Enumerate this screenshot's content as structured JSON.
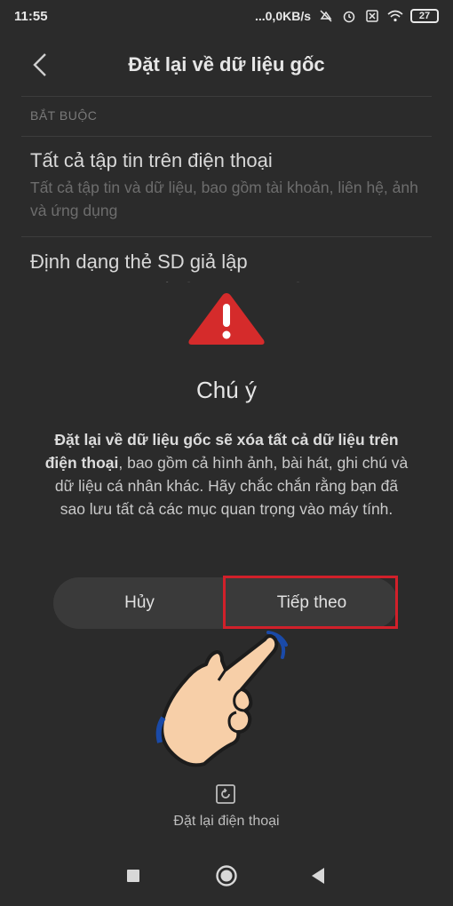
{
  "status_bar": {
    "time": "11:55",
    "net_speed": "...0,0KB/s",
    "battery": "27",
    "icons": [
      "mute-icon",
      "alarm-icon",
      "sim-off-icon",
      "wifi-icon",
      "battery-icon"
    ]
  },
  "header": {
    "title": "Đặt lại về dữ liệu gốc",
    "back_icon": "chevron-left-icon"
  },
  "section_label": "BẮT BUỘC",
  "options": [
    {
      "title": "Tất cả tập tin trên điện thoại",
      "desc": "Tất cả tập tin và dữ liệu, bao gồm tài khoản, liên hệ, ảnh và ứng dụng"
    },
    {
      "title": "Định dạng thẻ SD giả lập",
      "desc": "Định dạng sẽ xóa tất cả dữ liệu trên thẻ SD"
    }
  ],
  "dialog": {
    "icon": "warning-icon",
    "title": "Chú ý",
    "body_bold": "Đặt lại về dữ liệu gốc sẽ xóa tất cả dữ liệu trên điện thoại",
    "body_rest": ", bao gồm cả hình ảnh, bài hát, ghi chú và dữ liệu cá nhân khác. Hãy chắc chắn rằng bạn đã sao lưu tất cả các mục quan trọng vào máy tính.",
    "cancel_label": "Hủy",
    "next_label": "Tiếp theo",
    "highlight_color": "#d1202a"
  },
  "reset": {
    "icon": "reset-icon",
    "label": "Đặt lại điện thoại"
  },
  "nav_bar": {
    "icons": [
      "recents-icon",
      "home-icon",
      "back-icon"
    ]
  }
}
